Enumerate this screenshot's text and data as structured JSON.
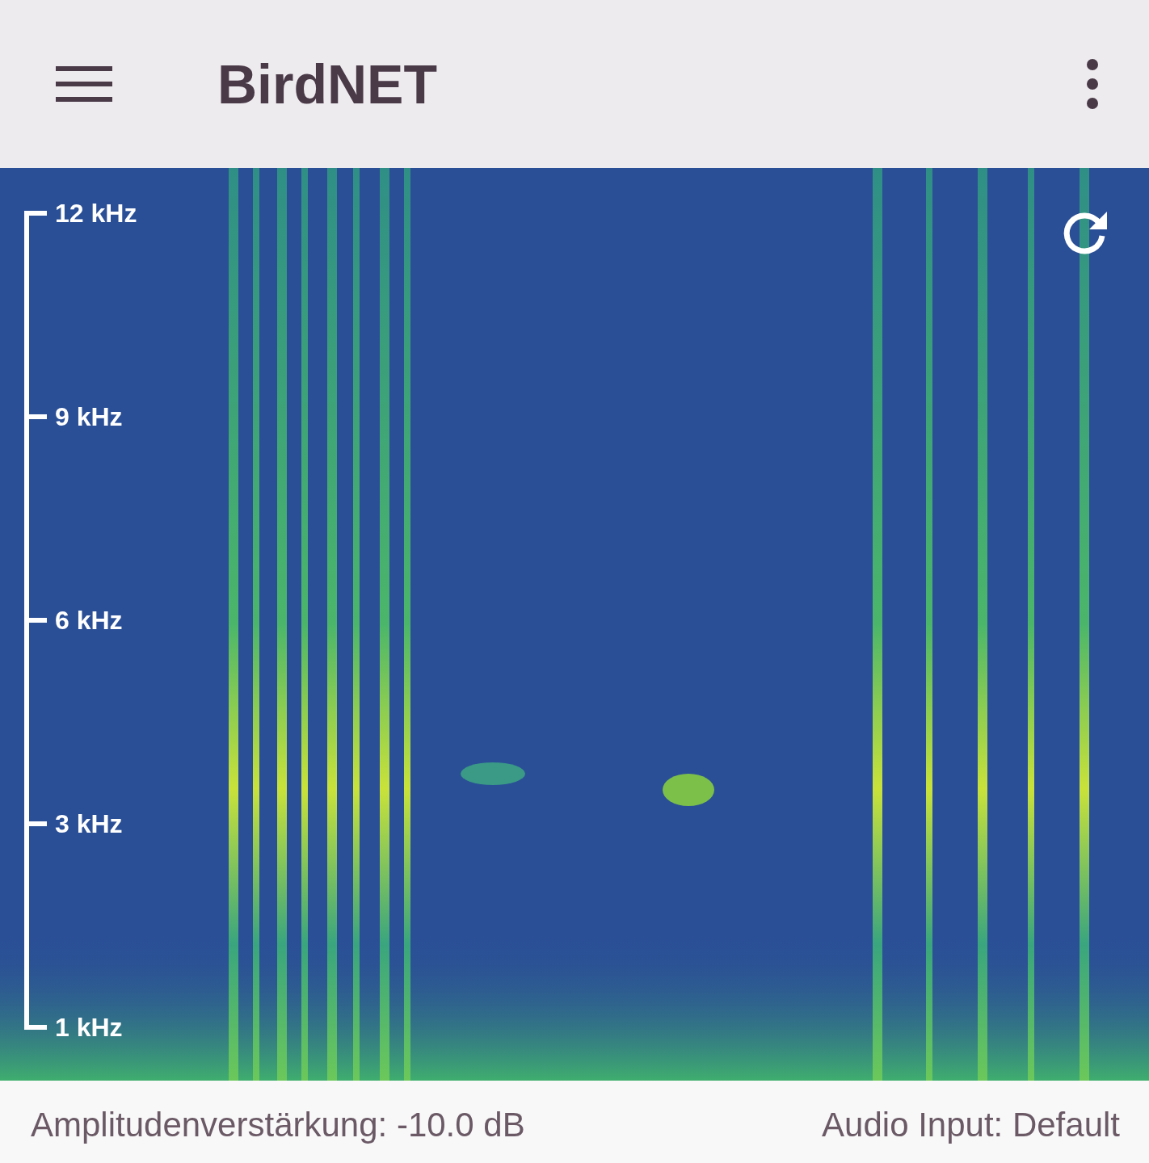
{
  "app_bar": {
    "title": "BirdNET"
  },
  "spectrogram": {
    "kind": "picture",
    "frequency_scale": [
      "12 kHz",
      "9 kHz",
      "6 kHz",
      "3 kHz",
      "1 kHz"
    ]
  },
  "status_bar": {
    "gain": "Amplitudenverstärkung: -10.0 dB",
    "audio_input": "Audio Input: Default"
  }
}
